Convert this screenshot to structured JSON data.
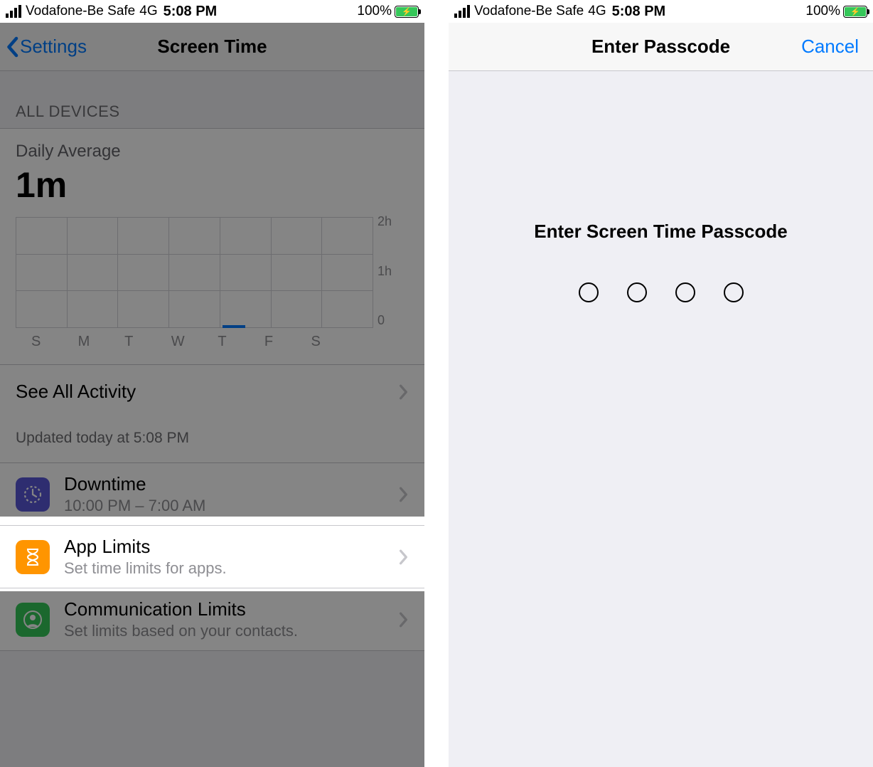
{
  "status_bar": {
    "carrier": "Vodafone-Be Safe",
    "connection": "4G",
    "time": "5:08 PM",
    "battery_pct": "100%"
  },
  "left": {
    "nav_back": "Settings",
    "nav_title": "Screen Time",
    "section_header": "ALL DEVICES",
    "usage": {
      "label": "Daily Average",
      "value": "1m",
      "updated": "Updated today at 5:08 PM",
      "see_all": "See All Activity"
    },
    "items": [
      {
        "title": "Downtime",
        "subtitle": "10:00 PM – 7:00 AM",
        "icon": "downtime",
        "color": "purple"
      },
      {
        "title": "App Limits",
        "subtitle": "Set time limits for apps.",
        "icon": "hourglass",
        "color": "orange"
      },
      {
        "title": "Communication Limits",
        "subtitle": "Set limits based on your contacts.",
        "icon": "contact",
        "color": "green"
      }
    ]
  },
  "right": {
    "title": "Enter Passcode",
    "cancel": "Cancel",
    "prompt": "Enter Screen Time Passcode",
    "digits": 4
  },
  "chart_data": {
    "type": "bar",
    "categories": [
      "S",
      "M",
      "T",
      "W",
      "T",
      "F",
      "S"
    ],
    "values": [
      0,
      0,
      0,
      0,
      1,
      0,
      0
    ],
    "ylabels": [
      "2h",
      "1h",
      "0"
    ],
    "ylim": [
      0,
      120
    ],
    "title": "Daily Average",
    "xlabel": "",
    "ylabel": ""
  }
}
